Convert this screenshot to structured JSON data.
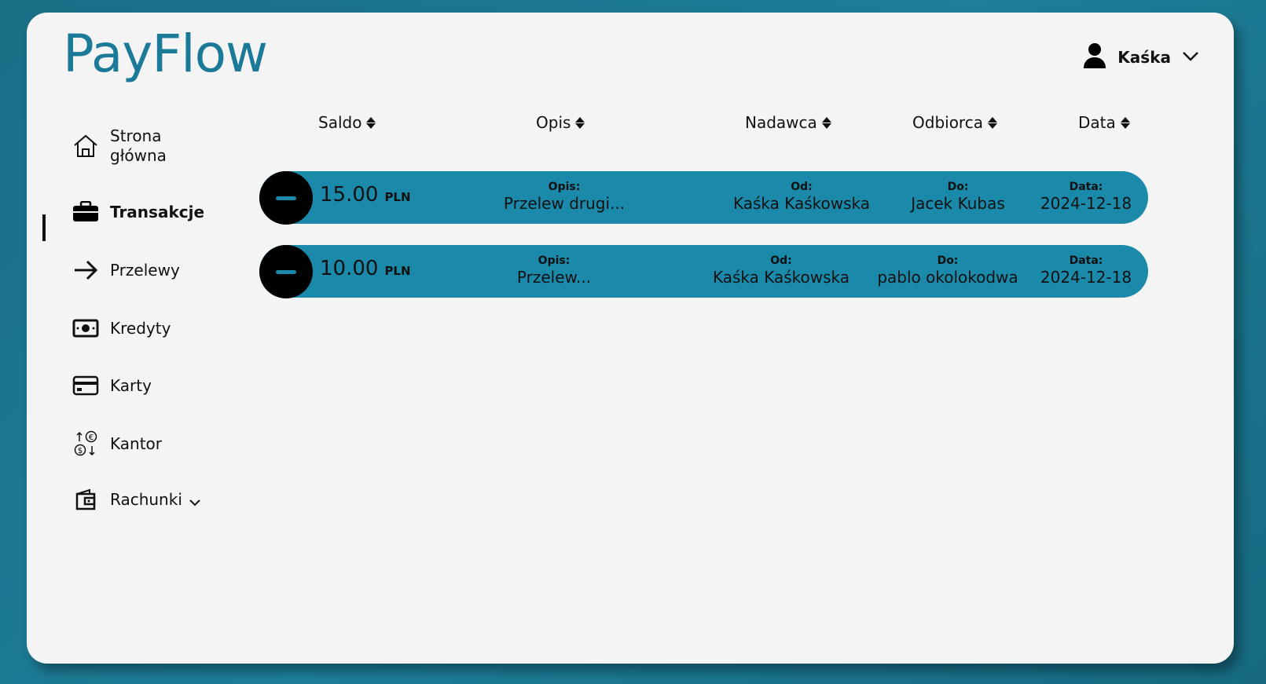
{
  "app": {
    "logo_text": "PayFlow"
  },
  "user": {
    "name": "Kaśka"
  },
  "sidebar": {
    "items": [
      {
        "label": "Strona\ngłówna",
        "icon": "home-icon"
      },
      {
        "label": "Transakcje",
        "icon": "briefcase-icon",
        "active": true
      },
      {
        "label": "Przelewy",
        "icon": "arrow-right-icon"
      },
      {
        "label": "Kredyty",
        "icon": "banknote-icon"
      },
      {
        "label": "Karty",
        "icon": "credit-card-icon"
      },
      {
        "label": "Kantor",
        "icon": "currency-exchange-icon"
      },
      {
        "label": "Rachunki",
        "icon": "wallet-icon"
      }
    ]
  },
  "table": {
    "columns": [
      "Saldo",
      "Opis",
      "Nadawca",
      "Odbiorca",
      "Data"
    ],
    "row_labels": {
      "desc": "Opis:",
      "from": "Od:",
      "to": "Do:",
      "date": "Data:"
    },
    "rows": [
      {
        "amount": "15.00",
        "currency": "PLN",
        "desc": "Przelew drugi...",
        "from": "Kaśka Kaśkowska",
        "to": "Jacek Kubas",
        "date": "2024-12-18"
      },
      {
        "amount": "10.00",
        "currency": "PLN",
        "desc": "Przelew...",
        "from": "Kaśka Kaśkowska",
        "to": "pablo okolokodwa",
        "date": "2024-12-18"
      }
    ]
  },
  "colors": {
    "accent": "#1a89aa",
    "background": "#1b7a98",
    "card": "#f4f4f4"
  }
}
